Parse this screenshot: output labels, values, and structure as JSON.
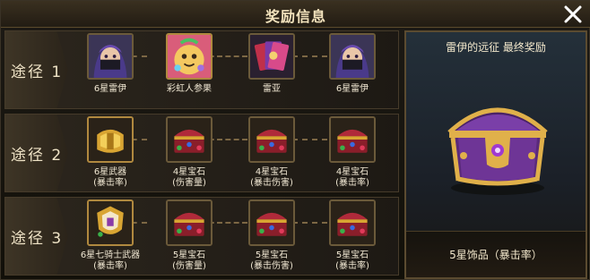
{
  "window": {
    "title": "奖励信息",
    "close_icon": "close-icon"
  },
  "routes": [
    {
      "label": "途径 1",
      "items": [
        {
          "icon": "ninja-portrait-icon",
          "name": "6星雷伊",
          "sub": ""
        },
        {
          "icon": "rainbow-ginseng-icon",
          "name": "彩虹人参果",
          "sub": ""
        },
        {
          "icon": "card-pack-icon",
          "name": "雷亚",
          "sub": ""
        },
        {
          "icon": "ninja-portrait-icon",
          "name": "6星雷伊",
          "sub": ""
        }
      ]
    },
    {
      "label": "途径 2",
      "items": [
        {
          "icon": "gold-weapon-icon",
          "name": "6星武器",
          "sub": "(暴击率)"
        },
        {
          "icon": "gem-chest-icon",
          "name": "4星宝石",
          "sub": "(伤害量)"
        },
        {
          "icon": "gem-chest-icon",
          "name": "4星宝石",
          "sub": "(暴击伤害)"
        },
        {
          "icon": "gem-chest-icon",
          "name": "4星宝石",
          "sub": "(暴击率)"
        }
      ]
    },
    {
      "label": "途径 3",
      "items": [
        {
          "icon": "knight-weapon-icon",
          "name": "6星七骑士武器",
          "sub": "(暴击率)"
        },
        {
          "icon": "gem-chest-icon",
          "name": "5星宝石",
          "sub": "(伤害量)"
        },
        {
          "icon": "gem-chest-icon",
          "name": "5星宝石",
          "sub": "(暴击伤害)"
        },
        {
          "icon": "gem-chest-icon",
          "name": "5星宝石",
          "sub": "(暴击率)"
        }
      ]
    }
  ],
  "final_reward": {
    "title": "雷伊的远征 最终奖励",
    "icon": "treasure-chest-icon",
    "name": "5星饰品（暴击率）"
  },
  "colors": {
    "accent_gold": "#b0893f",
    "chest_purple": "#5a2a7a",
    "panel_blue": "#24303a"
  }
}
